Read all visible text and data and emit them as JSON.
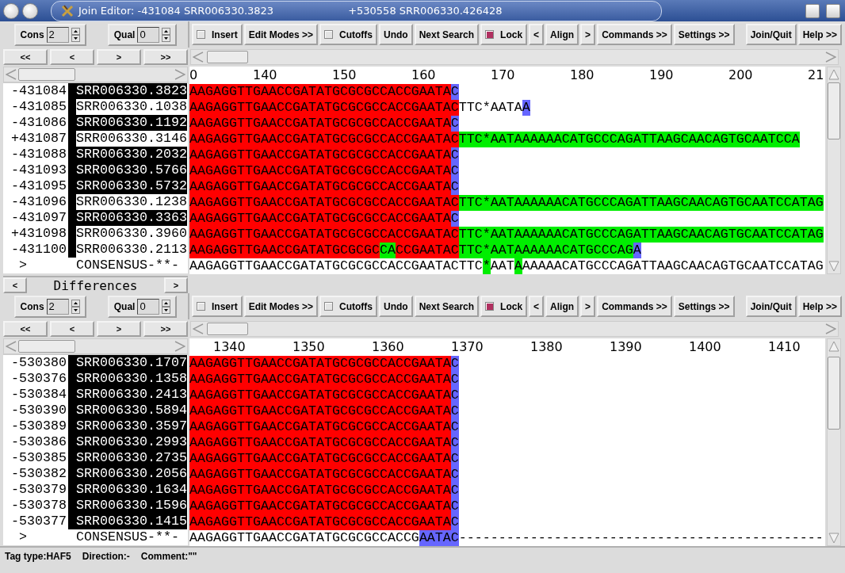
{
  "window": {
    "title": "Join Editor: -431084 SRR006330.3823",
    "title_right": "+530558 SRR006330.426428"
  },
  "panels": [
    {
      "spinners": [
        {
          "label": "Cons",
          "value": "2"
        },
        {
          "label": "Qual",
          "value": "0"
        }
      ],
      "tools": [
        {
          "kind": "checkbox",
          "label": "Insert",
          "checked": false
        },
        {
          "kind": "button",
          "label": "Edit Modes >>"
        },
        {
          "kind": "checkbox",
          "label": "Cutoffs",
          "checked": false
        },
        {
          "kind": "button",
          "label": "Undo"
        },
        {
          "kind": "button",
          "label": "Next Search"
        },
        {
          "kind": "checkbox",
          "label": "Lock",
          "checked": true
        },
        {
          "kind": "button",
          "label": "<"
        },
        {
          "kind": "button",
          "label": "Align"
        },
        {
          "kind": "button",
          "label": ">"
        },
        {
          "kind": "button",
          "label": "Commands >>"
        },
        {
          "kind": "button",
          "label": "Settings >>"
        }
      ],
      "tools_right": [
        "Join/Quit",
        "Help >>"
      ],
      "nav": [
        "<<",
        "<",
        ">",
        ">>"
      ],
      "ruler": [
        "0",
        "140",
        "150",
        "160",
        "170",
        "180",
        "190",
        "200",
        "21"
      ],
      "rows": [
        {
          "number": "-431084",
          "name": "SRR006330.3823",
          "highlighted": true,
          "segments": [
            {
              "text": "AAGAGGTTGAACCGATATGCGCGCCACCGAATA",
              "color": "#ff0000"
            },
            {
              "text": "C",
              "color": "#6666ff"
            }
          ]
        },
        {
          "number": "-431085",
          "name": "SRR006330.1038",
          "highlighted": false,
          "segments": [
            {
              "text": "AAGAGGTTGAACCGATATGCGCGCCACCGAATAC",
              "color": "#ff0000"
            },
            {
              "text": "TTC*AATA"
            },
            {
              "text": "A",
              "color": "#6666ff"
            }
          ]
        },
        {
          "number": "-431086",
          "name": "SRR006330.1192",
          "highlighted": true,
          "segments": [
            {
              "text": "AAGAGGTTGAACCGATATGCGCGCCACCGAATA",
              "color": "#ff0000"
            },
            {
              "text": "C",
              "color": "#6666ff"
            }
          ]
        },
        {
          "number": "+431087",
          "name": "SRR006330.3146",
          "highlighted": false,
          "segments": [
            {
              "text": "AAGAGGTTGAACCGATATGCGCGCCACCGAATAC",
              "color": "#ff0000"
            },
            {
              "text": "TTC*AATAAAAAACATGCCCAGATTAAGCAACAGTGCAATCCA",
              "color": "#00ee00"
            }
          ]
        },
        {
          "number": "-431088",
          "name": "SRR006330.2032",
          "highlighted": true,
          "segments": [
            {
              "text": "AAGAGGTTGAACCGATATGCGCGCCACCGAATA",
              "color": "#ff0000"
            },
            {
              "text": "C",
              "color": "#6666ff"
            }
          ]
        },
        {
          "number": "-431093",
          "name": "SRR006330.5766",
          "highlighted": true,
          "segments": [
            {
              "text": "AAGAGGTTGAACCGATATGCGCGCCACCGAATA",
              "color": "#ff0000"
            },
            {
              "text": "C",
              "color": "#6666ff"
            }
          ]
        },
        {
          "number": "-431095",
          "name": "SRR006330.5732",
          "highlighted": true,
          "segments": [
            {
              "text": "AAGAGGTTGAACCGATATGCGCGCCACCGAATA",
              "color": "#ff0000"
            },
            {
              "text": "C",
              "color": "#6666ff"
            }
          ]
        },
        {
          "number": "-431096",
          "name": "SRR006330.1238",
          "highlighted": false,
          "segments": [
            {
              "text": "AAGAGGTTGAACCGATATGCGCGCCACCGAATAC",
              "color": "#ff0000"
            },
            {
              "text": "TTC*AATAAAAAACATGCCCAGATTAAGCAACAGTGCAATCCATAG",
              "color": "#00ee00"
            }
          ]
        },
        {
          "number": "-431097",
          "name": "SRR006330.3363",
          "highlighted": true,
          "segments": [
            {
              "text": "AAGAGGTTGAACCGATATGCGCGCCACCGAATA",
              "color": "#ff0000"
            },
            {
              "text": "C",
              "color": "#6666ff"
            }
          ]
        },
        {
          "number": "+431098",
          "name": "SRR006330.3960",
          "highlighted": false,
          "segments": [
            {
              "text": "AAGAGGTTGAACCGATATGCGCGCCACCGAATAC",
              "color": "#ff0000"
            },
            {
              "text": "TTC*AATAAAAAACATGCCCAGATTAAGCAACAGTGCAATCCATAG",
              "color": "#00ee00"
            }
          ]
        },
        {
          "number": "-431100",
          "name": "SRR006330.2113",
          "highlighted": false,
          "segments": [
            {
              "text": "AAGAGGTTGAACCGATATGCGCGC",
              "color": "#ff0000"
            },
            {
              "text": "CA",
              "color": "#00ee00"
            },
            {
              "text": "CCGAATAC",
              "color": "#ff0000"
            },
            {
              "text": "TTC*AATAAAAAACATGCCCAG",
              "color": "#00ee00"
            },
            {
              "text": "A",
              "color": "#6666ff"
            }
          ]
        }
      ],
      "consensus": {
        "marker": ">",
        "name": "CONSENSUS",
        "flag": "-**-",
        "segments": [
          {
            "text": "AAGAGGTTGAACCGATATGCGCGCCACCGAATACTTC"
          },
          {
            "text": "*",
            "color": "#00ee00"
          },
          {
            "text": "AAT"
          },
          {
            "text": "A",
            "color": "#00ee00"
          },
          {
            "text": "AAAAACATGCCCAGATTAAGCAACAGTGCAATCCATAG"
          }
        ]
      }
    },
    {
      "spinners": [
        {
          "label": "Cons",
          "value": "2"
        },
        {
          "label": "Qual",
          "value": "0"
        }
      ],
      "tools": [
        {
          "kind": "checkbox",
          "label": "Insert",
          "checked": false
        },
        {
          "kind": "button",
          "label": "Edit Modes >>"
        },
        {
          "kind": "checkbox",
          "label": "Cutoffs",
          "checked": false
        },
        {
          "kind": "button",
          "label": "Undo"
        },
        {
          "kind": "button",
          "label": "Next Search"
        },
        {
          "kind": "checkbox",
          "label": "Lock",
          "checked": true
        },
        {
          "kind": "button",
          "label": "<"
        },
        {
          "kind": "button",
          "label": "Align"
        },
        {
          "kind": "button",
          "label": ">"
        },
        {
          "kind": "button",
          "label": "Commands >>"
        },
        {
          "kind": "button",
          "label": "Settings >>"
        }
      ],
      "tools_right": [
        "Join/Quit",
        "Help >>"
      ],
      "nav": [
        "<<",
        "<",
        ">",
        ">>"
      ],
      "ruler": [
        "1340",
        "1350",
        "1360",
        "1370",
        "1380",
        "1390",
        "1400",
        "1410"
      ],
      "rows": [
        {
          "number": "-530380",
          "name": "SRR006330.1707",
          "highlighted": true,
          "segments": [
            {
              "text": "AAGAGGTTGAACCGATATGCGCGCCACCGAATA",
              "color": "#ff0000"
            },
            {
              "text": "C",
              "color": "#6666ff"
            }
          ]
        },
        {
          "number": "-530376",
          "name": "SRR006330.1358",
          "highlighted": true,
          "segments": [
            {
              "text": "AAGAGGTTGAACCGATATGCGCGCCACCGAATA",
              "color": "#ff0000"
            },
            {
              "text": "C",
              "color": "#6666ff"
            }
          ]
        },
        {
          "number": "-530384",
          "name": "SRR006330.2413",
          "highlighted": true,
          "segments": [
            {
              "text": "AAGAGGTTGAACCGATATGCGCGCCACCGAATA",
              "color": "#ff0000"
            },
            {
              "text": "C",
              "color": "#6666ff"
            }
          ]
        },
        {
          "number": "-530390",
          "name": "SRR006330.5894",
          "highlighted": true,
          "segments": [
            {
              "text": "AAGAGGTTGAACCGATATGCGCGCCACCGAATA",
              "color": "#ff0000"
            },
            {
              "text": "C",
              "color": "#6666ff"
            }
          ]
        },
        {
          "number": "-530389",
          "name": "SRR006330.3597",
          "highlighted": true,
          "segments": [
            {
              "text": "AAGAGGTTGAACCGATATGCGCGCCACCGAATA",
              "color": "#ff0000"
            },
            {
              "text": "C",
              "color": "#6666ff"
            }
          ]
        },
        {
          "number": "-530386",
          "name": "SRR006330.2993",
          "highlighted": true,
          "segments": [
            {
              "text": "AAGAGGTTGAACCGATATGCGCGCCACCGAATA",
              "color": "#ff0000"
            },
            {
              "text": "C",
              "color": "#6666ff"
            }
          ]
        },
        {
          "number": "-530385",
          "name": "SRR006330.2735",
          "highlighted": true,
          "segments": [
            {
              "text": "AAGAGGTTGAACCGATATGCGCGCCACCGAATA",
              "color": "#ff0000"
            },
            {
              "text": "C",
              "color": "#6666ff"
            }
          ]
        },
        {
          "number": "-530382",
          "name": "SRR006330.2056",
          "highlighted": true,
          "segments": [
            {
              "text": "AAGAGGTTGAACCGATATGCGCGCCACCGAATA",
              "color": "#ff0000"
            },
            {
              "text": "C",
              "color": "#6666ff"
            }
          ]
        },
        {
          "number": "-530379",
          "name": "SRR006330.1634",
          "highlighted": true,
          "segments": [
            {
              "text": "AAGAGGTTGAACCGATATGCGCGCCACCGAATA",
              "color": "#ff0000"
            },
            {
              "text": "C",
              "color": "#6666ff"
            }
          ]
        },
        {
          "number": "-530378",
          "name": "SRR006330.1596",
          "highlighted": true,
          "segments": [
            {
              "text": "AAGAGGTTGAACCGATATGCGCGCCACCGAATA",
              "color": "#ff0000"
            },
            {
              "text": "C",
              "color": "#6666ff"
            }
          ]
        },
        {
          "number": "-530377",
          "name": "SRR006330.1415",
          "highlighted": true,
          "segments": [
            {
              "text": "AAGAGGTTGAACCGATATGCGCGCCACCGAATA",
              "color": "#ff0000"
            },
            {
              "text": "C",
              "color": "#6666ff"
            }
          ]
        }
      ],
      "consensus": {
        "marker": ">",
        "name": "CONSENSUS",
        "flag": "-**-",
        "segments": [
          {
            "text": "AAGAGGTTGAACCGATATGCGCGCCACCG"
          },
          {
            "text": "AATAC",
            "color": "#6666ff"
          },
          {
            "text": "----------------------------------------------"
          }
        ]
      }
    }
  ],
  "differences": {
    "prev": "<",
    "label": "Differences",
    "next": ">"
  },
  "status_bar": [
    "Tag type:HAF5",
    "Direction:-",
    "Comment:\"\""
  ]
}
